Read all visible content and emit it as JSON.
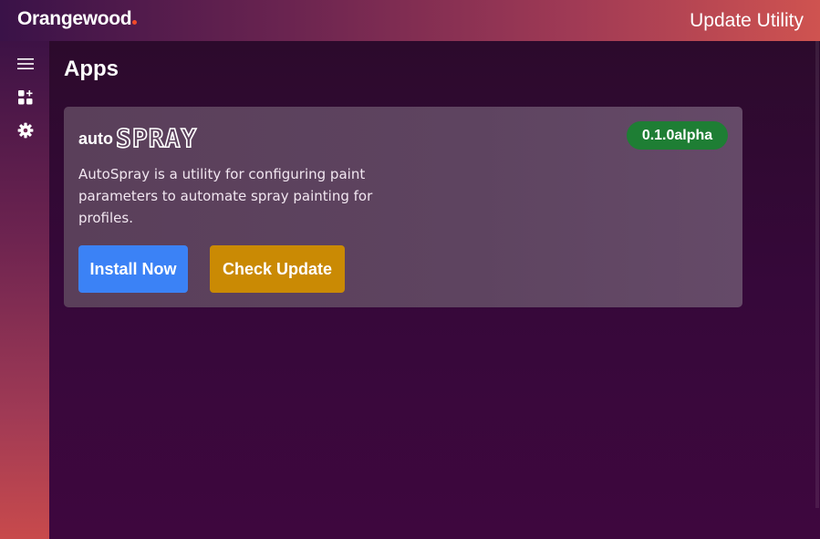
{
  "header": {
    "logo_text": "Orangewood",
    "app_title": "Update Utility"
  },
  "sidebar": {
    "items": [
      {
        "icon": "menu-icon",
        "label": "Menu"
      },
      {
        "icon": "apps-icon",
        "label": "Apps"
      },
      {
        "icon": "gear-icon",
        "label": "Settings"
      }
    ]
  },
  "main": {
    "title": "Apps",
    "apps": [
      {
        "brand_prefix": "auto",
        "brand_name": "SPRAY",
        "version": "0.1.0alpha",
        "description": "AutoSpray is a utility for configuring paint parameters to automate spray painting for profiles.",
        "install_label": "Install Now",
        "update_label": "Check Update"
      }
    ]
  },
  "colors": {
    "install_button": "#3b82f6",
    "update_button": "#ca8a04",
    "version_badge": "#1e7e34",
    "logo_dot": "#f04a2a"
  }
}
